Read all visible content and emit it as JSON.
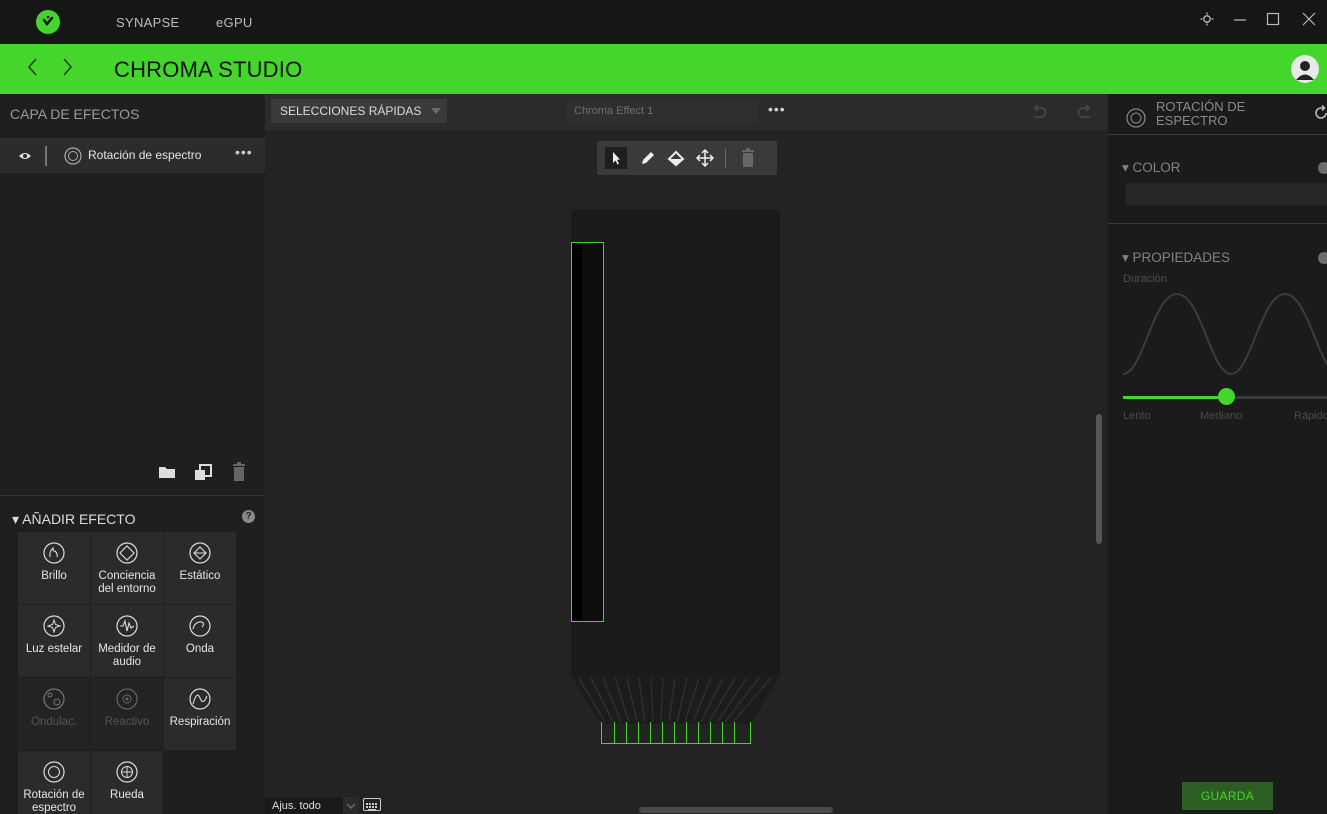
{
  "app": {
    "tabs": [
      "SYNAPSE",
      "eGPU"
    ],
    "page_title": "CHROMA STUDIO",
    "accent_color": "#44d62c"
  },
  "left_panel": {
    "title": "CAPA DE EFECTOS",
    "layers": [
      {
        "name": "Rotación de espectro",
        "icon": "spectrum-icon"
      }
    ],
    "more": "•••",
    "add_effect_title": "AÑADIR EFECTO",
    "help": "?",
    "effects": [
      {
        "label": "Brillo",
        "icon": "fire-icon",
        "enabled": true
      },
      {
        "label": "Conciencia del entorno",
        "icon": "ambient-icon",
        "enabled": true
      },
      {
        "label": "Estático",
        "icon": "static-icon",
        "enabled": true
      },
      {
        "label": "Luz estelar",
        "icon": "starlight-icon",
        "enabled": true
      },
      {
        "label": "Medidor de audio",
        "icon": "audio-meter-icon",
        "enabled": true
      },
      {
        "label": "Onda",
        "icon": "wave-icon",
        "enabled": true
      },
      {
        "label": "Ondulac.",
        "icon": "ripple-icon",
        "enabled": false
      },
      {
        "label": "Reactivo",
        "icon": "reactive-icon",
        "enabled": false
      },
      {
        "label": "Respiración",
        "icon": "breathing-icon",
        "enabled": true
      },
      {
        "label": "Rotación de espectro",
        "icon": "spectrum-icon",
        "enabled": true
      },
      {
        "label": "Rueda",
        "icon": "wheel-icon",
        "enabled": true
      }
    ]
  },
  "center": {
    "quick_select": "SELECCIONES RÁPIDAS",
    "effect_name": "Chroma Effect 1",
    "more": "•••",
    "zoom": "Ajus. todo"
  },
  "right_panel": {
    "title": "ROTACIÓN DE ESPECTRO",
    "color_section": "COLOR",
    "properties_section": "PROPIEDADES",
    "duration_label": "Duración",
    "speed_labels": [
      "Lento",
      "Mediano",
      "Rápido"
    ],
    "speed_value": "Mediano",
    "save": "GUARDA"
  }
}
